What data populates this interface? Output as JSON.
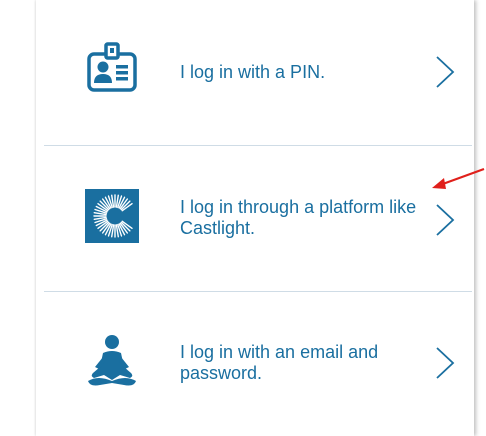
{
  "login_options": [
    {
      "label": "I log in with a PIN.",
      "icon": "id-badge-icon"
    },
    {
      "label": "I log in through a platform like Castlight.",
      "icon": "castlight-logo-icon"
    },
    {
      "label": "I log in with an email and password.",
      "icon": "meditation-person-icon"
    }
  ],
  "colors": {
    "accent": "#1a6fa0",
    "divider": "#cfdce6",
    "annotation_arrow": "#e0201b"
  }
}
